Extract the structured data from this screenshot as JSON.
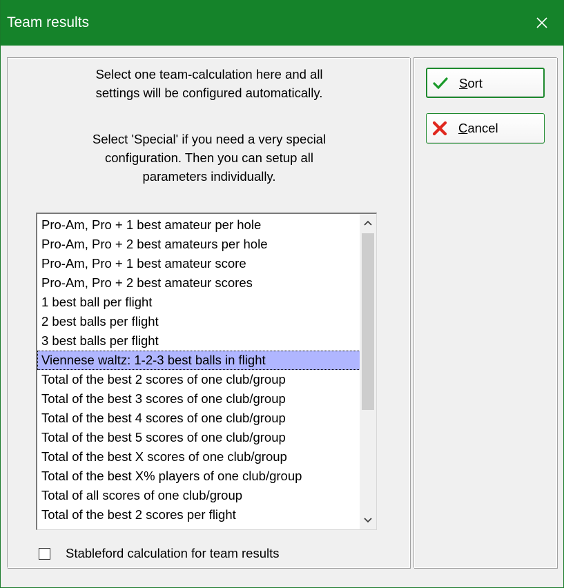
{
  "window": {
    "title": "Team results",
    "colors": {
      "titlebar": "#15832a",
      "selection": "#b0b6ff"
    },
    "close_icon": "close-icon"
  },
  "info": {
    "line1": "Select one team-calculation here and all",
    "line2": "settings will be configured automatically.",
    "line3": "Select 'Special' if you need a very special",
    "line4": "configuration. Then you can setup all",
    "line5": "parameters individually."
  },
  "list": {
    "selected_index": 7,
    "items": [
      "Pro-Am, Pro + 1 best amateur per hole",
      "Pro-Am, Pro + 2 best amateurs per hole",
      "Pro-Am, Pro + 1 best amateur score",
      "Pro-Am, Pro + 2 best amateur scores",
      "1 best ball per flight",
      "2 best balls per flight",
      "3 best balls per flight",
      "Viennese waltz: 1-2-3 best balls in flight",
      "Total of the best 2 scores of one club/group",
      "Total of the best 3 scores of one club/group",
      "Total of the best 4 scores of one club/group",
      "Total of the best 5 scores of one club/group",
      "Total of the best X scores of one club/group",
      "Total of the best X% players of one club/group",
      "Total of all scores of one club/group",
      "Total of the best 2 scores per flight"
    ]
  },
  "checkbox": {
    "label": "Stableford calculation for team results",
    "checked": false
  },
  "buttons": {
    "sort": {
      "mnemonic": "S",
      "rest": "ort",
      "icon": "checkmark-icon"
    },
    "cancel": {
      "mnemonic": "C",
      "rest": "ancel",
      "icon": "x-icon"
    }
  }
}
